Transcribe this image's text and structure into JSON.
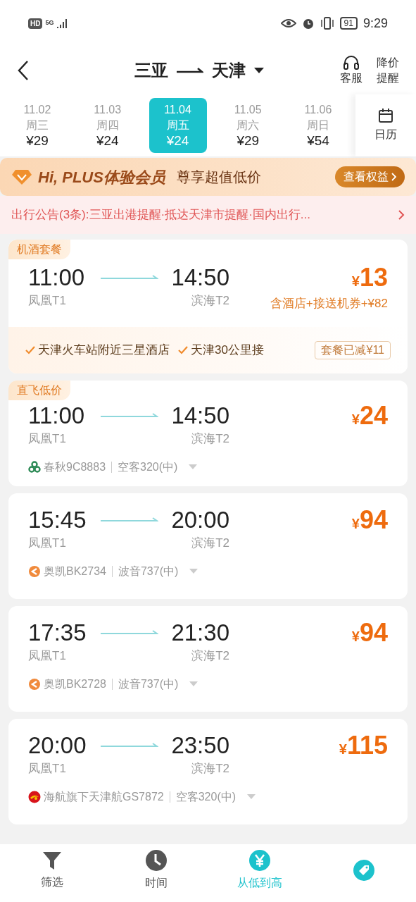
{
  "status_bar": {
    "left": [
      "HD",
      "5G"
    ],
    "battery": "91",
    "time": "9:29"
  },
  "header": {
    "from": "三亚",
    "to": "天津",
    "actions": [
      {
        "kind": "headset",
        "lines": [
          "客服"
        ]
      },
      {
        "kind": "text",
        "lines": [
          "降价",
          "提醒"
        ]
      }
    ]
  },
  "dates": [
    {
      "date": "11.02",
      "weekday": "周三",
      "price": "¥29",
      "selected": false
    },
    {
      "date": "11.03",
      "weekday": "周四",
      "price": "¥24",
      "selected": false
    },
    {
      "date": "11.04",
      "weekday": "周五",
      "price": "¥24",
      "selected": true
    },
    {
      "date": "11.05",
      "weekday": "周六",
      "price": "¥29",
      "selected": false
    },
    {
      "date": "11.06",
      "weekday": "周日",
      "price": "¥54",
      "selected": false
    }
  ],
  "calendar": {
    "label": "日历"
  },
  "plus_banner": {
    "title": "Hi, PLUS体验会员",
    "subtitle": "尊享超值低价",
    "button": "查看权益"
  },
  "notice": {
    "text": "出行公告(3条):三亚出港提醒·抵达天津市提醒·国内出行..."
  },
  "flights": [
    {
      "kind": "package",
      "tag": "机酒套餐",
      "dep_time": "11:00",
      "dep_airport": "凤凰T1",
      "arr_time": "14:50",
      "arr_airport": "滨海T2",
      "currency": "¥",
      "price": "13",
      "price_note": "含酒店+接送机券+¥82",
      "perks": [
        "天津火车站附近三星酒店",
        "天津30公里接"
      ],
      "discount": "套餐已减¥11"
    },
    {
      "kind": "flight",
      "tag": "直飞低价",
      "dep_time": "11:00",
      "dep_airport": "凤凰T1",
      "arr_time": "14:50",
      "arr_airport": "滨海T2",
      "currency": "¥",
      "price": "24",
      "logo": {
        "kind": "spring"
      },
      "airline": "春秋9C8883",
      "aircraft": "空客320(中)"
    },
    {
      "kind": "flight",
      "dep_time": "15:45",
      "dep_airport": "凤凰T1",
      "arr_time": "20:00",
      "arr_airport": "滨海T2",
      "currency": "¥",
      "price": "94",
      "logo": {
        "kind": "okay"
      },
      "airline": "奥凯BK2734",
      "aircraft": "波音737(中)"
    },
    {
      "kind": "flight",
      "dep_time": "17:35",
      "dep_airport": "凤凰T1",
      "arr_time": "21:30",
      "arr_airport": "滨海T2",
      "currency": "¥",
      "price": "94",
      "logo": {
        "kind": "okay"
      },
      "airline": "奥凯BK2728",
      "aircraft": "波音737(中)"
    },
    {
      "kind": "flight",
      "dep_time": "20:00",
      "dep_airport": "凤凰T1",
      "arr_time": "23:50",
      "arr_airport": "滨海T2",
      "currency": "¥",
      "price": "115",
      "logo": {
        "kind": "hainan"
      },
      "airline": "海航旗下天津航GS7872",
      "aircraft": "空客320(中)"
    }
  ],
  "bottom_tabs": [
    {
      "kind": "filter",
      "label": "筛选",
      "selected": false
    },
    {
      "kind": "clock",
      "label": "时间",
      "selected": false
    },
    {
      "kind": "yen",
      "label": "从低到高",
      "selected": true
    },
    {
      "kind": "tag",
      "selected": true
    }
  ]
}
